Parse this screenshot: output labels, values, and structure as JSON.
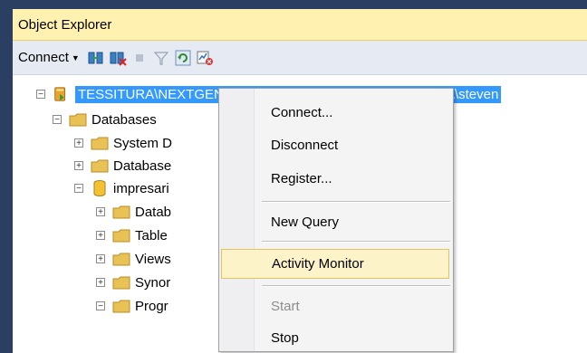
{
  "panel": {
    "title": "Object Explorer"
  },
  "toolbar": {
    "connect_label": "Connect"
  },
  "tree": {
    "server_label": "TESSITURA\\NEXTGEN (SQL Server 12.0.2269 - TESSITURA\\steven",
    "items": [
      {
        "label": "Databases"
      },
      {
        "label": "System D"
      },
      {
        "label": "Database"
      },
      {
        "label": "impresari"
      },
      {
        "label": "Datab"
      },
      {
        "label": "Table"
      },
      {
        "label": "Views"
      },
      {
        "label": "Synor"
      },
      {
        "label": "Progr"
      }
    ]
  },
  "context_menu": {
    "items": [
      {
        "label": "Connect..."
      },
      {
        "label": "Disconnect"
      },
      {
        "label": "Register..."
      },
      {
        "label": "New Query"
      },
      {
        "label": "Activity Monitor"
      },
      {
        "label": "Start"
      },
      {
        "label": "Stop"
      }
    ]
  },
  "colors": {
    "selection": "#3399ff",
    "hover_highlight": "#fcf3c9",
    "title_bar": "#fff2b0",
    "folder": "#e8c254"
  }
}
